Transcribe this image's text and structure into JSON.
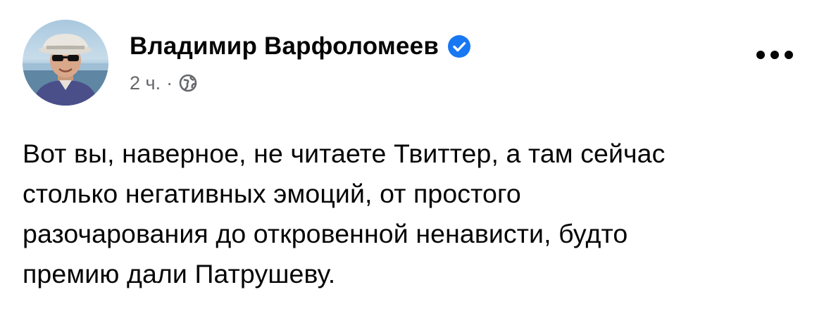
{
  "post": {
    "author": {
      "name": "Владимир Варфоломеев",
      "verified": true,
      "avatar_icon": "profile-photo"
    },
    "meta": {
      "time": "2 ч.",
      "separator": "·",
      "audience_icon": "globe-icon"
    },
    "menu_icon": "more-options-icon",
    "text": "Вот вы, наверное, не читаете Твиттер, а там сейчас\nстолько негативных эмоций, от простого\nразочарования до откровенной ненависти, будто\nпремию дали Патрушеву."
  },
  "colors": {
    "text_primary": "#050505",
    "text_secondary": "#65676b",
    "verified_blue": "#1877f2",
    "background": "#ffffff"
  }
}
